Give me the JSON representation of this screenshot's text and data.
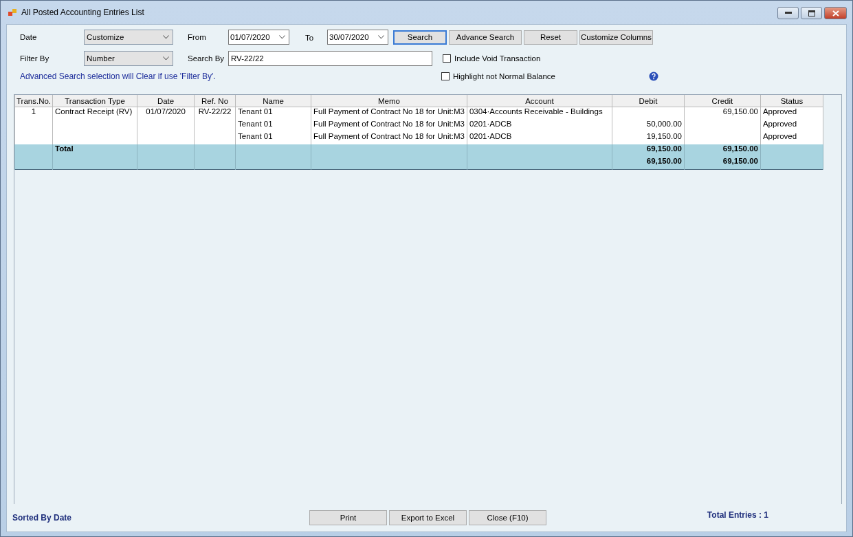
{
  "window": {
    "title": "All Posted Accounting Entries List"
  },
  "filters": {
    "date_label": "Date",
    "date_range": "Customize",
    "from_label": "From",
    "from": "01/07/2020",
    "to_label": "To",
    "to": "30/07/2020",
    "filter_by_label": "Filter By",
    "filter_by": "Number",
    "search_by_label": "Search By",
    "search_by": "RV-22/22",
    "note": "Advanced Search selection will Clear if use 'Filter By'.",
    "checkboxes": [
      {
        "label": "Include Void Transaction",
        "checked": false
      },
      {
        "label": "Highlight not Normal Balance",
        "checked": false
      }
    ]
  },
  "toolbar_buttons": [
    {
      "label": "Search",
      "focused": true
    },
    {
      "label": "Advance Search",
      "focused": false
    },
    {
      "label": "Reset",
      "focused": false
    },
    {
      "label": "Customize Columns",
      "focused": false
    }
  ],
  "table": {
    "columns": [
      "Trans.No.",
      "Transaction Type",
      "Date",
      "Ref. No",
      "Name",
      "Memo",
      "Account",
      "Debit",
      "Credit",
      "Status"
    ],
    "rows": [
      {
        "trans_no": "1",
        "type": "Contract Receipt (RV)",
        "date": "01/07/2020",
        "ref_no": "RV-22/22",
        "name": "Tenant 01",
        "memo": "Full Payment of Contract No 18 for Unit:M3",
        "account": "0304·Accounts Receivable - Buildings",
        "credit": "69,150.00",
        "status": "Approved"
      },
      {
        "name": "Tenant 01",
        "memo": "Full Payment of Contract No 18 for Unit:M3",
        "account": "0201·ADCB",
        "debit": "50,000.00",
        "status": "Approved"
      },
      {
        "name": "Tenant 01",
        "memo": "Full Payment of Contract No 18 for Unit:M3",
        "account": "0201·ADCB",
        "debit": "19,150.00",
        "status": "Approved"
      }
    ],
    "totals": [
      {
        "label": "Total",
        "debit": "69,150.00",
        "credit": "69,150.00"
      },
      {
        "debit": "69,150.00",
        "credit": "69,150.00"
      }
    ]
  },
  "status_bar": {
    "sort": "Sorted By Date",
    "buttons": [
      "Print",
      "Export to Excel",
      "Close (F10)"
    ],
    "total_entries": "Total Entries : 1"
  }
}
